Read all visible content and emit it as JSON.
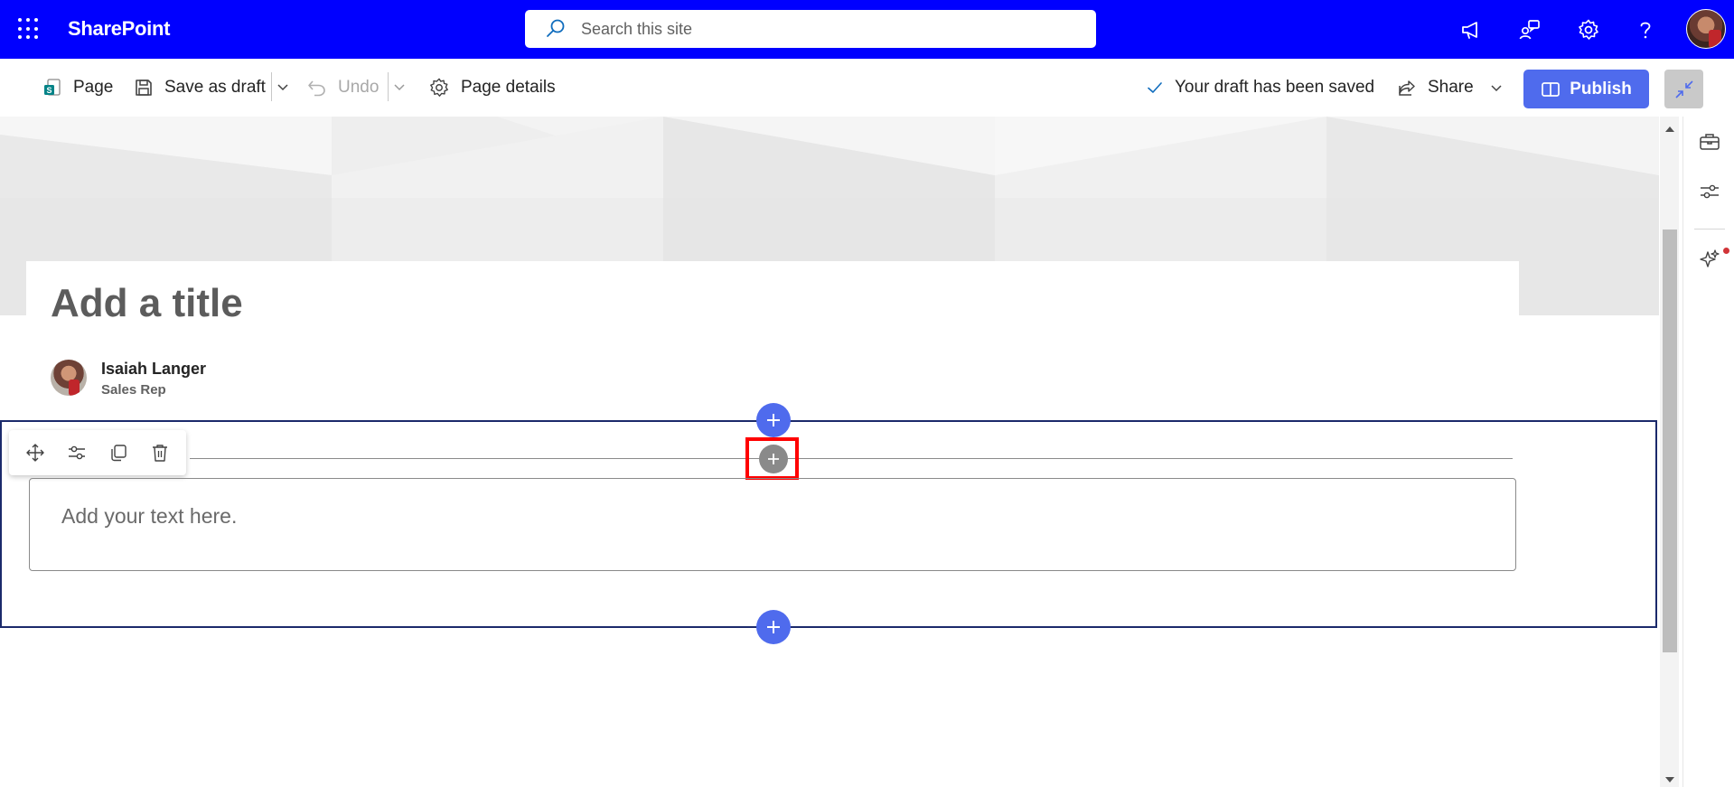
{
  "suite_bar": {
    "app_name": "SharePoint",
    "search_placeholder": "Search this site",
    "icons": [
      "waffle-icon",
      "megaphone-icon",
      "people-chat-icon",
      "gear-icon",
      "help-icon"
    ]
  },
  "command_bar": {
    "page_label": "Page",
    "save_draft_label": "Save as draft",
    "undo_label": "Undo",
    "page_details_label": "Page details",
    "status_text": "Your draft has been saved",
    "share_label": "Share",
    "publish_label": "Publish"
  },
  "page": {
    "title_placeholder": "Add a title",
    "author_name": "Isaiah Langer",
    "author_role": "Sales Rep",
    "text_placeholder": "Add your text here."
  },
  "section_toolbar": {
    "icons": [
      "move-icon",
      "edit-properties-icon",
      "duplicate-icon",
      "delete-icon"
    ]
  },
  "right_rail": {
    "icons": [
      "toolbox-icon",
      "settings-sliders-icon",
      "copilot-sparkle-icon"
    ]
  },
  "colors": {
    "suite_bar": "#0000ff",
    "accent": "#4f6bed",
    "highlight": "#ff0000"
  }
}
